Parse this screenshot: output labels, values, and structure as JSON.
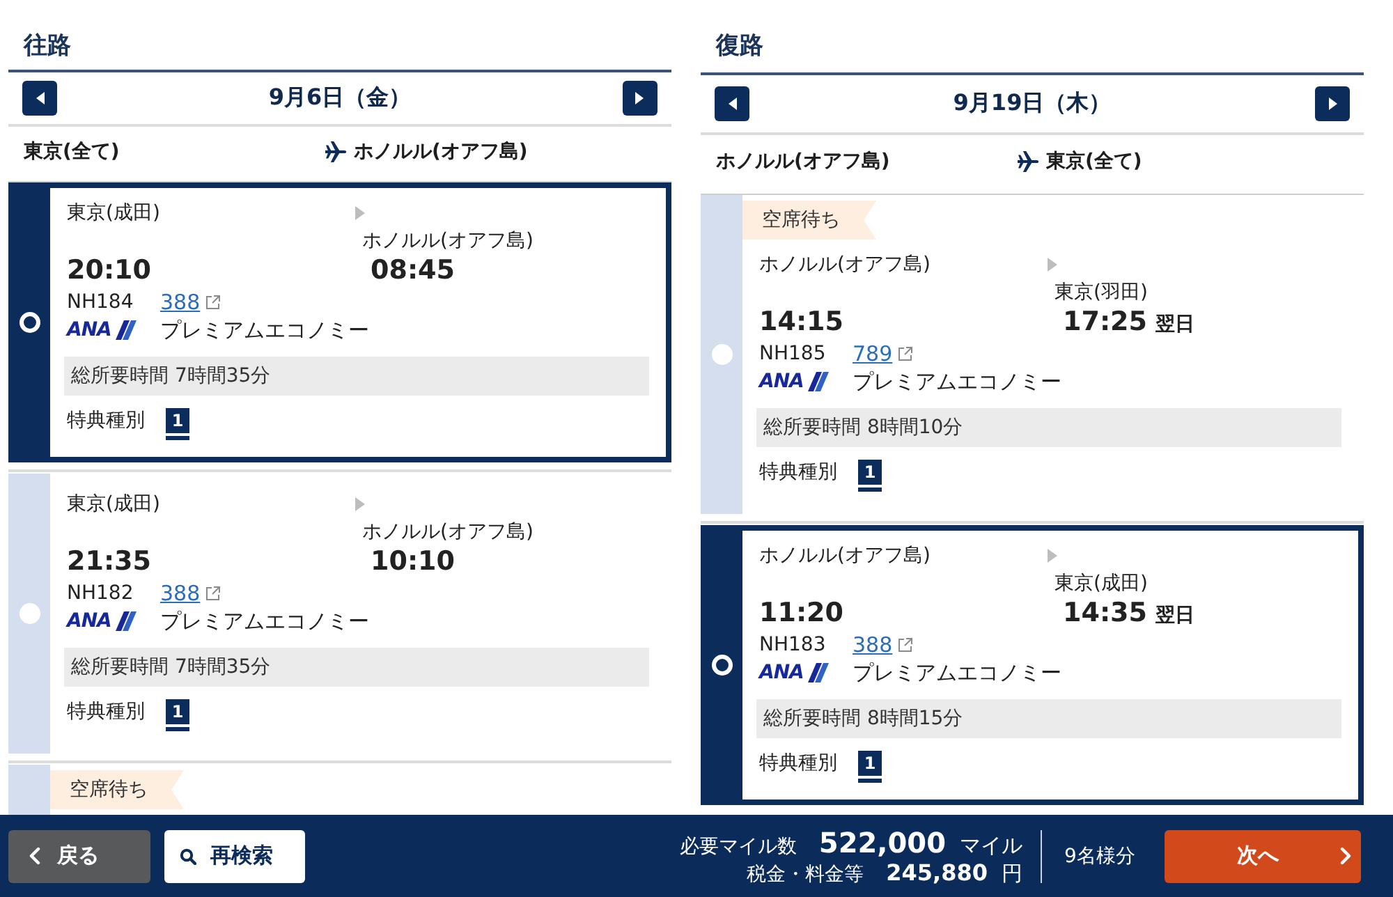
{
  "outbound": {
    "title": "往路",
    "date": "9月6日（金）",
    "route": {
      "from": "東京(全て)",
      "to": "ホノルル(オアフ島)"
    },
    "flights": [
      {
        "selected": true,
        "origin": "東京(成田)",
        "destination": "ホノルル(オアフ島)",
        "departure_time": "20:10",
        "arrival_time": "08:45",
        "flight_number": "NH184",
        "aircraft": "388",
        "airline_logo": "ANA",
        "cabin": "プレミアムエコノミー",
        "duration": "総所要時間 7時間35分",
        "award_type_label": "特典種別",
        "award_type": "1"
      },
      {
        "selected": false,
        "origin": "東京(成田)",
        "destination": "ホノルル(オアフ島)",
        "departure_time": "21:35",
        "arrival_time": "10:10",
        "flight_number": "NH182",
        "aircraft": "388",
        "airline_logo": "ANA",
        "cabin": "プレミアムエコノミー",
        "duration": "総所要時間 7時間35分",
        "award_type_label": "特典種別",
        "award_type": "1"
      },
      {
        "selected": false,
        "waitlist_tag": "空席待ち"
      }
    ]
  },
  "return": {
    "title": "復路",
    "date": "9月19日（木）",
    "route": {
      "from": "ホノルル(オアフ島)",
      "to": "東京(全て)"
    },
    "flights": [
      {
        "selected": false,
        "waitlist_tag": "空席待ち",
        "origin": "ホノルル(オアフ島)",
        "destination": "東京(羽田)",
        "departure_time": "14:15",
        "arrival_time": "17:25",
        "next_day": "翌日",
        "flight_number": "NH185",
        "aircraft": "789",
        "airline_logo": "ANA",
        "cabin": "プレミアムエコノミー",
        "duration": "総所要時間 8時間10分",
        "award_type_label": "特典種別",
        "award_type": "1"
      },
      {
        "selected": true,
        "origin": "ホノルル(オアフ島)",
        "destination": "東京(成田)",
        "departure_time": "11:20",
        "arrival_time": "14:35",
        "next_day": "翌日",
        "flight_number": "NH183",
        "aircraft": "388",
        "airline_logo": "ANA",
        "cabin": "プレミアムエコノミー",
        "duration": "総所要時間 8時間15分",
        "award_type_label": "特典種別",
        "award_type": "1"
      }
    ]
  },
  "footer": {
    "back_button": "戻る",
    "research_button": "再検索",
    "miles_label": "必要マイル数",
    "miles": "522,000",
    "miles_unit": "マイル",
    "tax_label": "税金・料金等",
    "tax": "245,880",
    "tax_unit": "円",
    "passengers": "9名様分",
    "next_button": "次へ"
  }
}
